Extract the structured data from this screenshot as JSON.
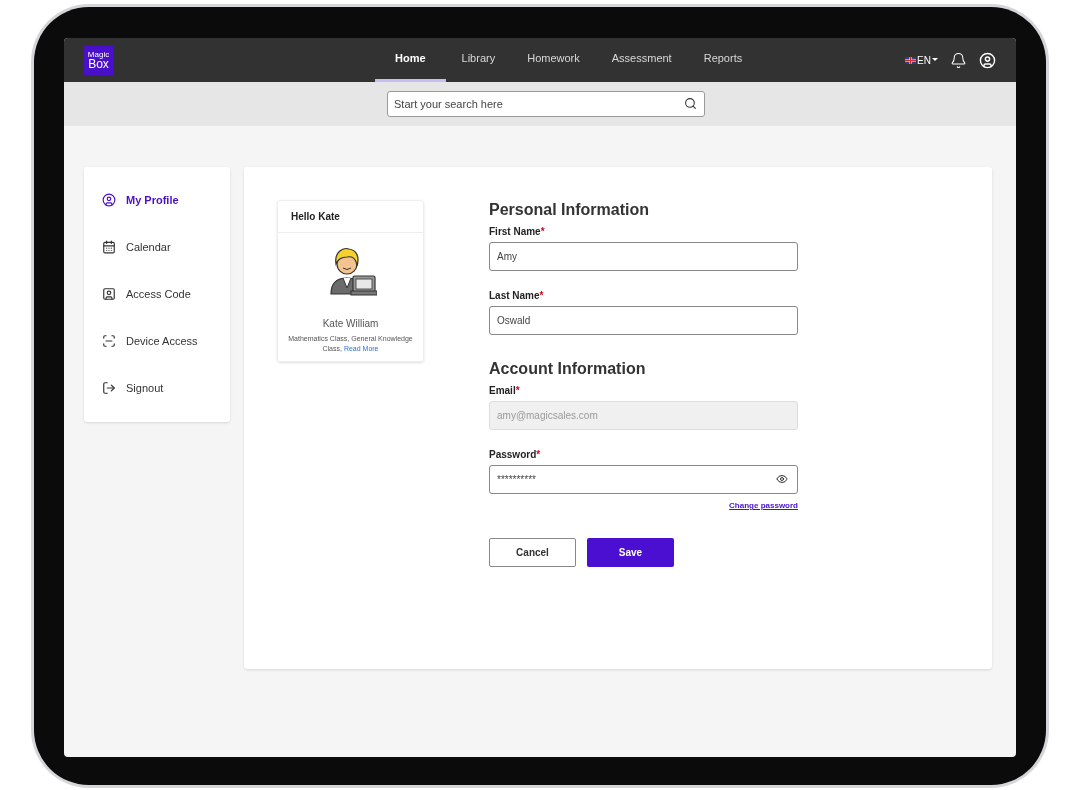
{
  "logo": {
    "top": "Magic",
    "bottom": "Box"
  },
  "nav": [
    {
      "label": "Home",
      "selected": true
    },
    {
      "label": "Library",
      "selected": false
    },
    {
      "label": "Homework",
      "selected": false
    },
    {
      "label": "Assessment",
      "selected": false
    },
    {
      "label": "Reports",
      "selected": false
    }
  ],
  "language": "EN",
  "search": {
    "placeholder": "Start your search here"
  },
  "sidebar": {
    "items": [
      {
        "label": "My Profile",
        "selected": true
      },
      {
        "label": "Calendar",
        "selected": false
      },
      {
        "label": "Access Code",
        "selected": false
      },
      {
        "label": "Device Access",
        "selected": false
      },
      {
        "label": "Signout",
        "selected": false
      }
    ]
  },
  "profile_card": {
    "greeting": "Hello Kate",
    "name": "Kate William",
    "classes": "Mathematics Class, General Knowledge Class,",
    "link": "Read More"
  },
  "sections": [
    {
      "title": "Personal Information",
      "fields": [
        {
          "label": "First Name",
          "required_mark": "*",
          "value": "Amy",
          "disabled": false,
          "kind": "text"
        },
        {
          "label": "Last Name",
          "required_mark": "*",
          "value": "Oswald",
          "disabled": false,
          "kind": "text"
        }
      ]
    },
    {
      "title": "Account Information",
      "fields": [
        {
          "label": "Email",
          "required_mark": "*",
          "value": "amy@magicsales.com",
          "disabled": true,
          "kind": "text"
        },
        {
          "label": "Password",
          "required_mark": "*",
          "value": "**********",
          "disabled": false,
          "kind": "password",
          "link": "Change password"
        }
      ]
    }
  ],
  "buttons": {
    "cancel": "Cancel",
    "save": "Save"
  }
}
